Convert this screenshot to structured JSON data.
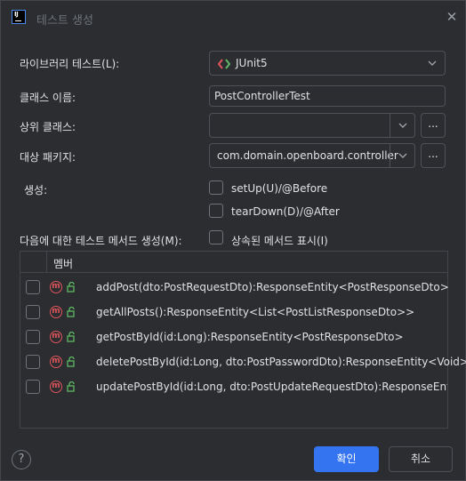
{
  "window": {
    "title": "테스트 생성",
    "close_glyph": "✕"
  },
  "form": {
    "library_label": "라이브러리 테스트(L):",
    "library_value": "JUnit5",
    "class_name_label": "클래스 이름:",
    "class_name_value": "PostControllerTest",
    "superclass_label": "상위 클래스:",
    "superclass_value": "",
    "package_label": "대상 패키지:",
    "package_value": "com.domain.openboard.controller",
    "ellipsis": "...",
    "generate_label": "생성:",
    "setup_label": "setUp(U)/@Before",
    "teardown_label": "tearDown(D)/@After",
    "methods_label": "다음에 대한 테스트 메서드 생성(M):",
    "inherited_label": "상속된 메서드 표시(I)"
  },
  "table": {
    "header": "멤버",
    "rows": [
      {
        "text": "addPost(dto:PostRequestDto):ResponseEntity<PostResponseDto>"
      },
      {
        "text": "getAllPosts():ResponseEntity<List<PostListResponseDto>>"
      },
      {
        "text": "getPostById(id:Long):ResponseEntity<PostResponseDto>"
      },
      {
        "text": "deletePostById(id:Long, dto:PostPasswordDto):ResponseEntity<Void>"
      },
      {
        "text": "updatePostById(id:Long, dto:PostUpdateRequestDto):ResponseEntity<PostResponseDto>"
      }
    ]
  },
  "footer": {
    "help": "?",
    "ok": "확인",
    "cancel": "취소"
  },
  "colors": {
    "background": "#2b2d30",
    "accent": "#3574f0",
    "method_icon": "#e0565c",
    "public_icon": "#5fb865"
  }
}
